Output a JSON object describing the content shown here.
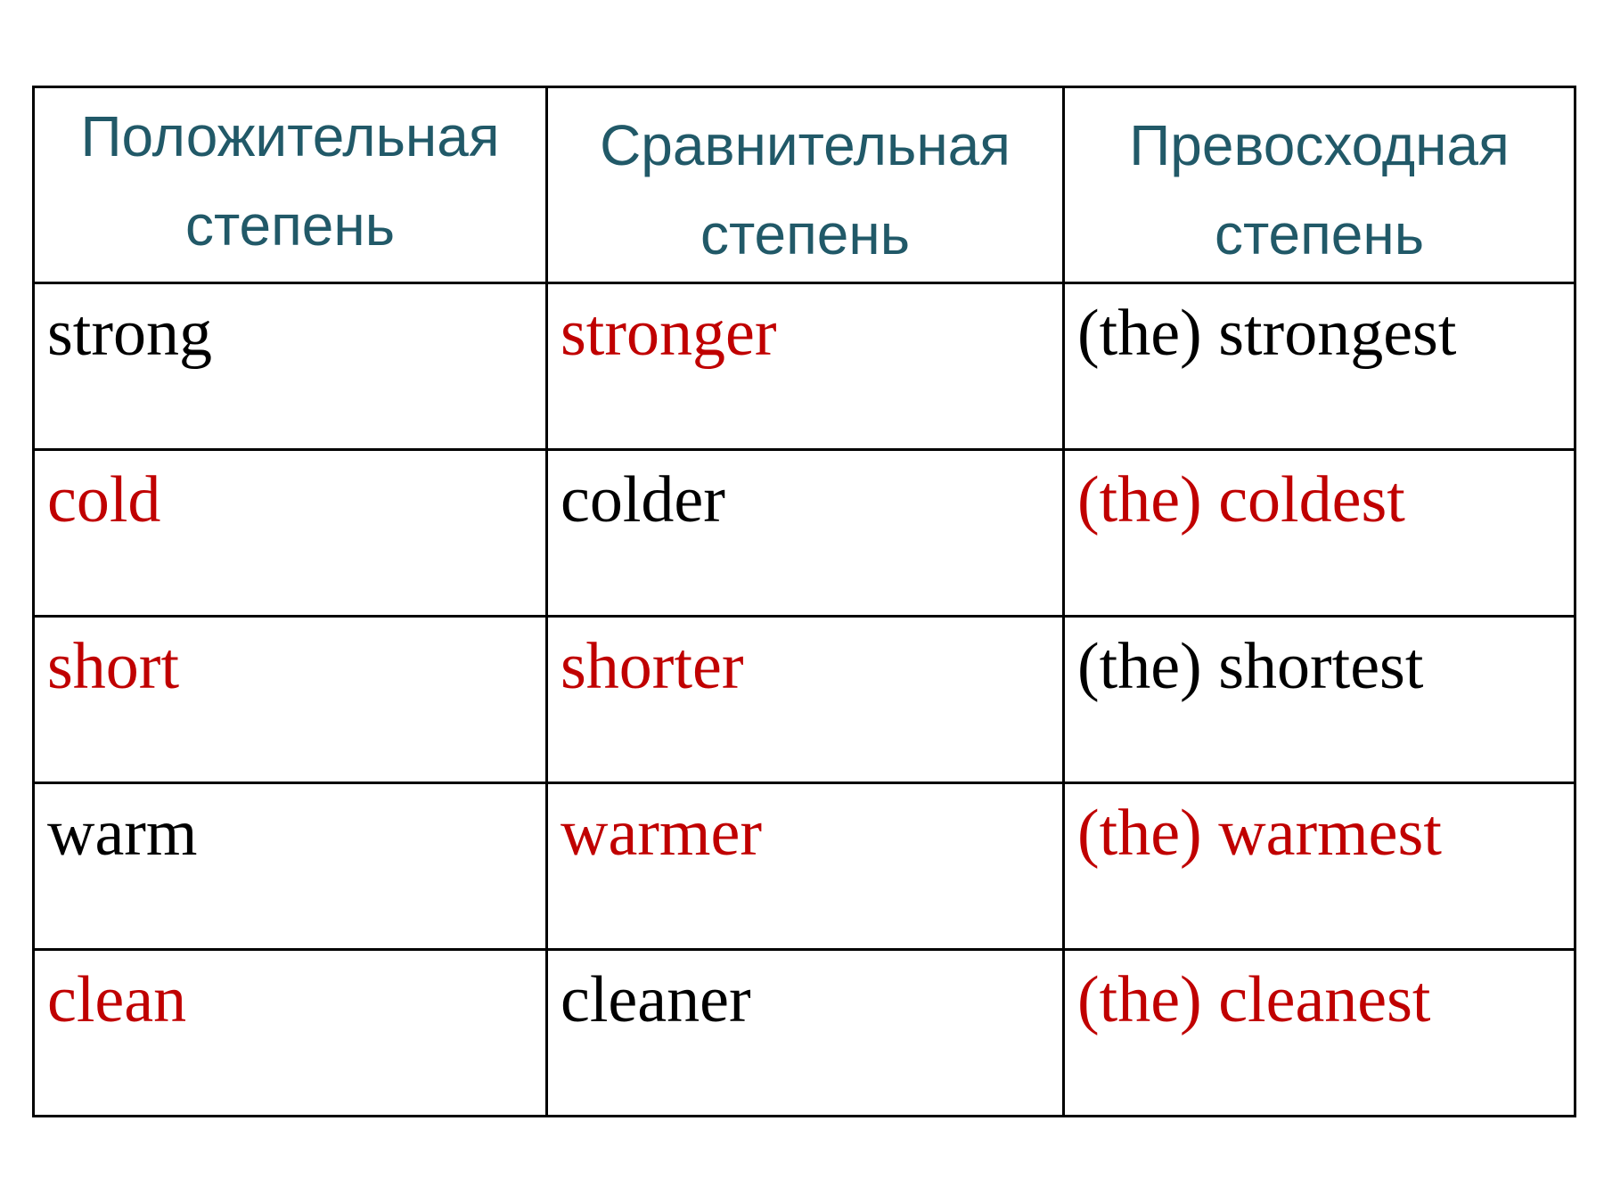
{
  "table": {
    "headers": [
      {
        "line1": "Положительная",
        "line2": "степень"
      },
      {
        "line1": "Сравнительная",
        "line2": "степень"
      },
      {
        "line1": "Превосходная",
        "line2": "степень"
      }
    ],
    "rows": [
      [
        {
          "text": "strong",
          "color": "black"
        },
        {
          "text": "stronger",
          "color": "red"
        },
        {
          "text": "(the) strongest",
          "color": "black"
        }
      ],
      [
        {
          "text": "cold",
          "color": "red"
        },
        {
          "text": "colder",
          "color": "black"
        },
        {
          "text": "(the) coldest",
          "color": "red"
        }
      ],
      [
        {
          "text": "short",
          "color": "red"
        },
        {
          "text": "shorter",
          "color": "red"
        },
        {
          "text": "(the) shortest",
          "color": "black"
        }
      ],
      [
        {
          "text": "warm",
          "color": "black"
        },
        {
          "text": "warmer",
          "color": "red"
        },
        {
          "text": "(the) warmest",
          "color": "red"
        }
      ],
      [
        {
          "text": "clean",
          "color": "red"
        },
        {
          "text": "cleaner",
          "color": "black"
        },
        {
          "text": "(the) cleanest",
          "color": "red"
        }
      ]
    ]
  },
  "colors": {
    "header": "#215968",
    "red": "#c00000",
    "black": "#000000"
  }
}
